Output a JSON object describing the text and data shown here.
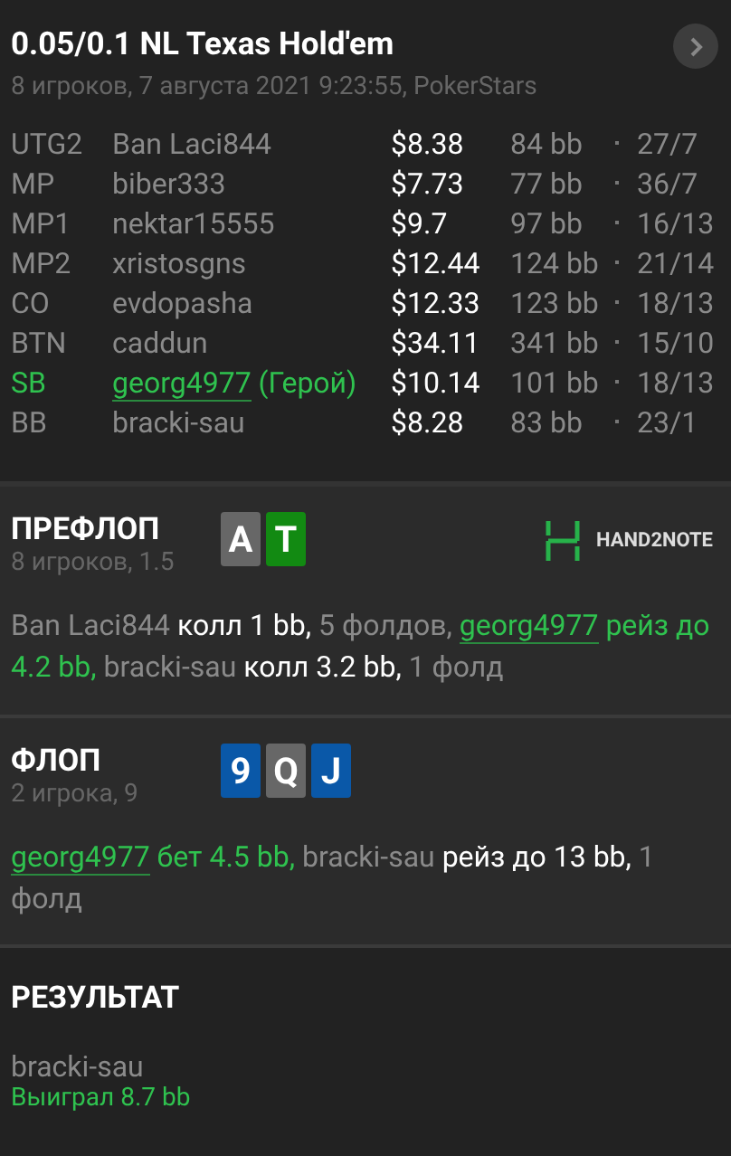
{
  "header": {
    "title": "0.05/0.1 NL Texas Hold'em",
    "subtitle": "8 игроков, 7 августа 2021 9:23:55, PokerStars"
  },
  "players": [
    {
      "position": "UTG2",
      "name": "Ban Laci844",
      "hero": false,
      "stack": "$8.38",
      "bb": "84 bb",
      "stats": "27/7"
    },
    {
      "position": "MP",
      "name": "biber333",
      "hero": false,
      "stack": "$7.73",
      "bb": "77 bb",
      "stats": "36/7"
    },
    {
      "position": "MP1",
      "name": "nektar15555",
      "hero": false,
      "stack": "$9.7",
      "bb": "97 bb",
      "stats": "16/13"
    },
    {
      "position": "MP2",
      "name": "xristosgns",
      "hero": false,
      "stack": "$12.44",
      "bb": "124 bb",
      "stats": "21/14"
    },
    {
      "position": "CO",
      "name": "evdopasha",
      "hero": false,
      "stack": "$12.33",
      "bb": "123 bb",
      "stats": "18/13"
    },
    {
      "position": "BTN",
      "name": "caddun",
      "hero": false,
      "stack": "$34.11",
      "bb": "341 bb",
      "stats": "15/10"
    },
    {
      "position": "SB",
      "name": "georg4977",
      "hero": true,
      "hero_tag": "(Герой)",
      "stack": "$10.14",
      "bb": "101 bb",
      "stats": "18/13"
    },
    {
      "position": "BB",
      "name": "bracki-sau",
      "hero": false,
      "stack": "$8.28",
      "bb": "83 bb",
      "stats": "23/1"
    }
  ],
  "streets": [
    {
      "title": "ПРЕФЛОП",
      "subtitle": "8 игроков, 1.5",
      "logo": "HAND2NOTE",
      "cards": [
        {
          "rank": "A",
          "color": "#676767"
        },
        {
          "rank": "T",
          "color": "#128a12"
        }
      ],
      "actions": [
        {
          "kind": "player",
          "text": "Ban Laci844"
        },
        {
          "kind": "action",
          "text": " колл 1 bb,"
        },
        {
          "kind": "muted",
          "text": " 5 фолдов, "
        },
        {
          "kind": "hero-name",
          "text": "georg4977"
        },
        {
          "kind": "hero-action",
          "text": " рейз до 4.2 bb,"
        },
        {
          "kind": "player",
          "text": " bracki-sau"
        },
        {
          "kind": "action",
          "text": " колл 3.2 bb,"
        },
        {
          "kind": "muted",
          "text": " 1 фолд"
        }
      ]
    },
    {
      "title": "ФЛОП",
      "subtitle": "2 игрока, 9",
      "cards": [
        {
          "rank": "9",
          "color": "#0a58a8"
        },
        {
          "rank": "Q",
          "color": "#676767"
        },
        {
          "rank": "J",
          "color": "#0a58a8"
        }
      ],
      "actions": [
        {
          "kind": "hero-name",
          "text": "georg4977"
        },
        {
          "kind": "hero-action",
          "text": " бет 4.5 bb,"
        },
        {
          "kind": "player",
          "text": " bracki-sau"
        },
        {
          "kind": "action",
          "text": " рейз до 13 bb,"
        },
        {
          "kind": "muted",
          "text": " 1 фолд"
        }
      ]
    }
  ],
  "result": {
    "title": "РЕЗУЛЬТАТ",
    "winner": "bracki-sau",
    "outcome": "Выиграл 8.7 bb"
  }
}
